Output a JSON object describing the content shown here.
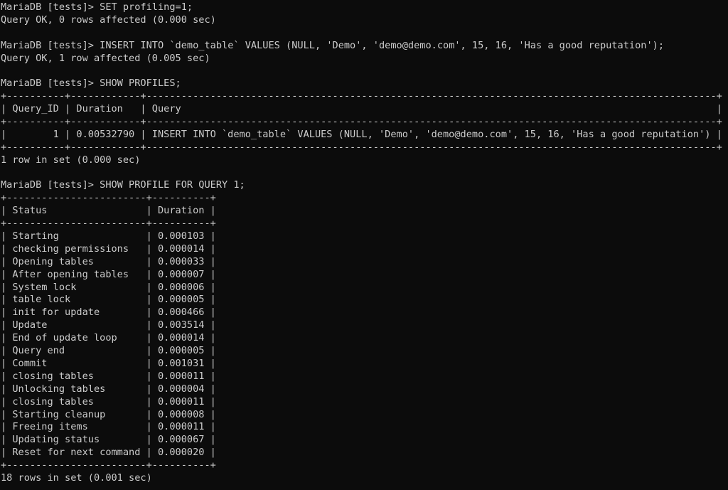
{
  "terminal": {
    "prompt": "MariaDB [tests]> ",
    "blocks": [
      {
        "command": "SET profiling=1;",
        "result": "Query OK, 0 rows affected (0.000 sec)"
      },
      {
        "command": "INSERT INTO `demo_table` VALUES (NULL, 'Demo', 'demo@demo.com', 15, 16, 'Has a good reputation');",
        "result": "Query OK, 1 row affected (0.005 sec)"
      },
      {
        "command": "SHOW PROFILES;",
        "table": {
          "columns": [
            "Query_ID",
            "Duration",
            "Query"
          ],
          "align": [
            "right",
            "left",
            "left"
          ],
          "rows": [
            [
              "1",
              "0.00532790",
              "INSERT INTO `demo_table` VALUES (NULL, 'Demo', 'demo@demo.com', 15, 16, 'Has a good reputation')"
            ]
          ]
        },
        "result": "1 row in set (0.000 sec)"
      },
      {
        "command": "SHOW PROFILE FOR QUERY 1;",
        "table": {
          "columns": [
            "Status",
            "Duration"
          ],
          "align": [
            "left",
            "left"
          ],
          "rows": [
            [
              "Starting",
              "0.000103"
            ],
            [
              "checking permissions",
              "0.000014"
            ],
            [
              "Opening tables",
              "0.000033"
            ],
            [
              "After opening tables",
              "0.000007"
            ],
            [
              "System lock",
              "0.000006"
            ],
            [
              "table lock",
              "0.000005"
            ],
            [
              "init for update",
              "0.000466"
            ],
            [
              "Update",
              "0.003514"
            ],
            [
              "End of update loop",
              "0.000014"
            ],
            [
              "Query end",
              "0.000005"
            ],
            [
              "Commit",
              "0.001031"
            ],
            [
              "closing tables",
              "0.000011"
            ],
            [
              "Unlocking tables",
              "0.000004"
            ],
            [
              "closing tables",
              "0.000011"
            ],
            [
              "Starting cleanup",
              "0.000008"
            ],
            [
              "Freeing items",
              "0.000011"
            ],
            [
              "Updating status",
              "0.000067"
            ],
            [
              "Reset for next command",
              "0.000020"
            ]
          ]
        },
        "result": "18 rows in set (0.001 sec)"
      }
    ]
  }
}
